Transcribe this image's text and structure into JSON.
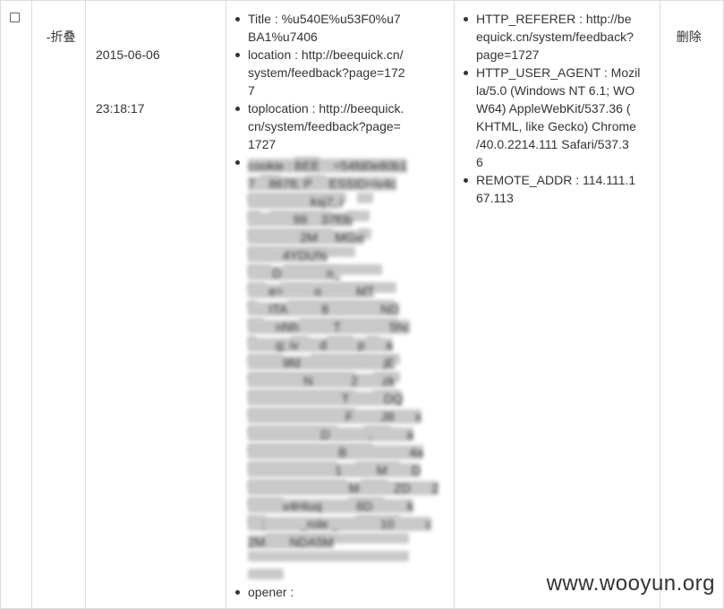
{
  "row": {
    "collapse_label": "-折叠",
    "date": "2015-06-06",
    "time": "23:18:17",
    "delete_label": "删除"
  },
  "params_left": {
    "title_lines": [
      "Title : %u540E%u53F0%u7",
      "BA1%u7406"
    ],
    "location_lines": [
      "location : http://beequick.cn/",
      "system/feedback?page=172",
      "7"
    ],
    "toplocation_lines": [
      "toplocation : http://beequick.",
      "cn/system/feedback?page=",
      "1727"
    ],
    "cookie_lines": [
      "cookie : BEE    =54fd0e80b1",
      "7    8678; P     ESSID=iv4c",
      "                  ksj7; i",
      "             99    37f0b",
      "               2M     MGxi",
      "          4YDU%",
      "       D             n_",
      "      e=         o          MT",
      "      ITA          8               ND",
      "        nNh          T              5hc",
      "        g; iv      d         p      a",
      "          9fd                        jE",
      "                N           2       zk",
      "                           T          DQ",
      "                            F        J8      x",
      "                     D           ,          a",
      "                          B                  4a",
      "                         1          M       D",
      "                             M          ZD      2",
      "          v4Hiuq          6D          k",
      "    ;          _role _            10         c",
      "2M       NDA5M",
      "",
      ""
    ],
    "opener_label": "opener :"
  },
  "params_right": {
    "referer_lines": [
      "HTTP_REFERER : http://be",
      "equick.cn/system/feedback?",
      "page=1727"
    ],
    "user_agent_lines": [
      "HTTP_USER_AGENT : Mozil",
      "la/5.0 (Windows NT 6.1; WO",
      "W64) AppleWebKit/537.36 (",
      "KHTML, like Gecko) Chrome",
      "/40.0.2214.111 Safari/537.3",
      "6"
    ],
    "remote_addr_lines": [
      "REMOTE_ADDR : 114.111.1",
      "67.113"
    ]
  },
  "watermark": "www.wooyun.org"
}
